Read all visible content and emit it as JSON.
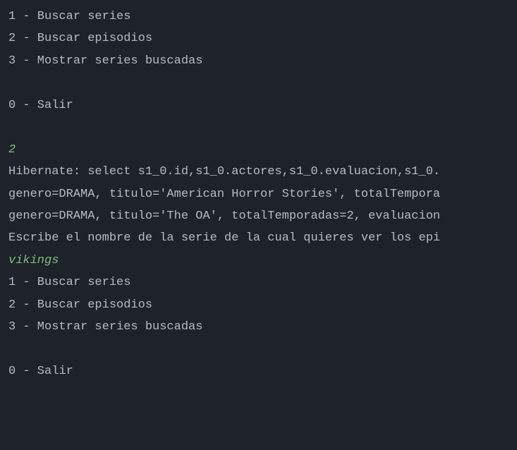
{
  "menu1": {
    "opt1": "1 - Buscar series",
    "opt2": "2 - Buscar episodios",
    "opt3": "3 - Mostrar series buscadas",
    "opt0": "0 - Salir"
  },
  "input1": "2",
  "output": {
    "hibernate": "Hibernate: select s1_0.id,s1_0.actores,s1_0.evaluacion,s1_0.",
    "row1": "genero=DRAMA, titulo='American Horror Stories', totalTempora",
    "row2": "genero=DRAMA, titulo='The OA', totalTemporadas=2, evaluacion",
    "prompt": "Escribe el nombre de la serie de la cual quieres ver los epi"
  },
  "input2": "vikings",
  "menu2": {
    "opt1": "1 - Buscar series",
    "opt2": "2 - Buscar episodios",
    "opt3": "3 - Mostrar series buscadas",
    "opt0": "0 - Salir"
  }
}
